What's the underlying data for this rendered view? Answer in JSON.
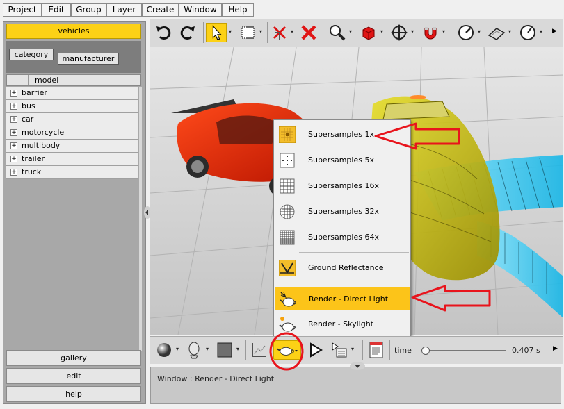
{
  "menubar": {
    "items": [
      "Project",
      "Edit",
      "Group",
      "Layer",
      "Create",
      "Window",
      "Help"
    ]
  },
  "left_panel": {
    "active_tab": "vehicles",
    "filters": {
      "category": "category",
      "manufacturer": "manufacturer"
    },
    "column_header": "model",
    "tree_items": [
      "barrier",
      "bus",
      "car",
      "motorcycle",
      "multibody",
      "trailer",
      "truck"
    ],
    "bottom_buttons": {
      "gallery": "gallery",
      "edit": "edit",
      "help": "help"
    }
  },
  "toolbar": {
    "icons": [
      "undo-icon",
      "redo-icon",
      "select-arrow-icon",
      "rectangle-select-icon",
      "delete-connection-icon",
      "delete-icon",
      "zoom-icon",
      "cube-icon",
      "move-icon",
      "magnet-icon",
      "gauge-icon",
      "road-icon",
      "speedometer-icon"
    ]
  },
  "context_menu": {
    "items": [
      {
        "label": "Supersamples 1x",
        "icon": "supersample-1x-icon"
      },
      {
        "label": "Supersamples 5x",
        "icon": "supersample-5x-icon"
      },
      {
        "label": "Supersamples 16x",
        "icon": "supersample-16x-icon"
      },
      {
        "label": "Supersamples 32x",
        "icon": "supersample-32x-icon"
      },
      {
        "label": "Supersamples 64x",
        "icon": "supersample-64x-icon"
      },
      {
        "label": "Ground Reflectance",
        "icon": "ground-reflectance-icon"
      },
      {
        "label": "Render - Direct Light",
        "icon": "teapot-direct-light-icon",
        "highlighted": true
      },
      {
        "label": "Render - Skylight",
        "icon": "teapot-skylight-icon"
      }
    ]
  },
  "bottom_toolbar": {
    "time_label": "time",
    "time_value": "0.407 s",
    "time_fraction": 0.02
  },
  "status": {
    "text": "Window : Render - Direct Light"
  },
  "colors": {
    "accent_yellow": "#fcd116",
    "highlight": "#fcc419",
    "annotation_red": "#e8141c"
  }
}
